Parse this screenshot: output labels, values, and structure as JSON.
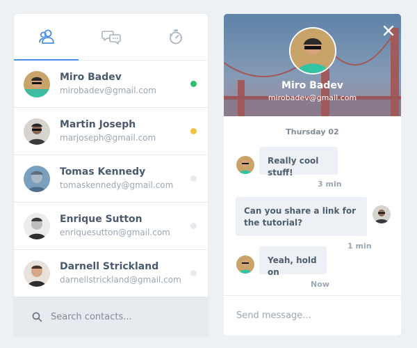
{
  "tabs": [
    {
      "icon": "users-icon"
    },
    {
      "icon": "chat-bubbles-icon"
    },
    {
      "icon": "stopwatch-icon"
    }
  ],
  "contacts": [
    {
      "name": "Miro Badev",
      "email": "mirobadev@gmail.com",
      "status_color": "#2bbf6f"
    },
    {
      "name": "Martin Joseph",
      "email": "marjoseph@gmail.com",
      "status_color": "#f3c340"
    },
    {
      "name": "Tomas Kennedy",
      "email": "tomaskennedy@gmail.com",
      "status_color": "#e6e9ee"
    },
    {
      "name": "Enrique Sutton",
      "email": "enriquesutton@gmail.com",
      "status_color": "#e6e9ee"
    },
    {
      "name": "Darnell Strickland",
      "email": "darnellstrickland@gmail.com",
      "status_color": "#e6e9ee"
    }
  ],
  "search": {
    "placeholder": "Search contacts..."
  },
  "profile": {
    "name": "Miro Badev",
    "email": "mirobadev@gmail.com"
  },
  "chat": {
    "day": "Thursday 02",
    "messages": [
      {
        "text": "Really cool stuff!",
        "time": "3 min"
      },
      {
        "text": "Can you share a link for the tutorial?",
        "time": "1 min"
      },
      {
        "text": "Yeah, hold on",
        "time": "Now"
      }
    ]
  },
  "composer": {
    "placeholder": "Send message..."
  },
  "colors": {
    "accent": "#4a8fe7",
    "online": "#2bbf6f",
    "away": "#f3c340",
    "offline": "#e6e9ee"
  }
}
